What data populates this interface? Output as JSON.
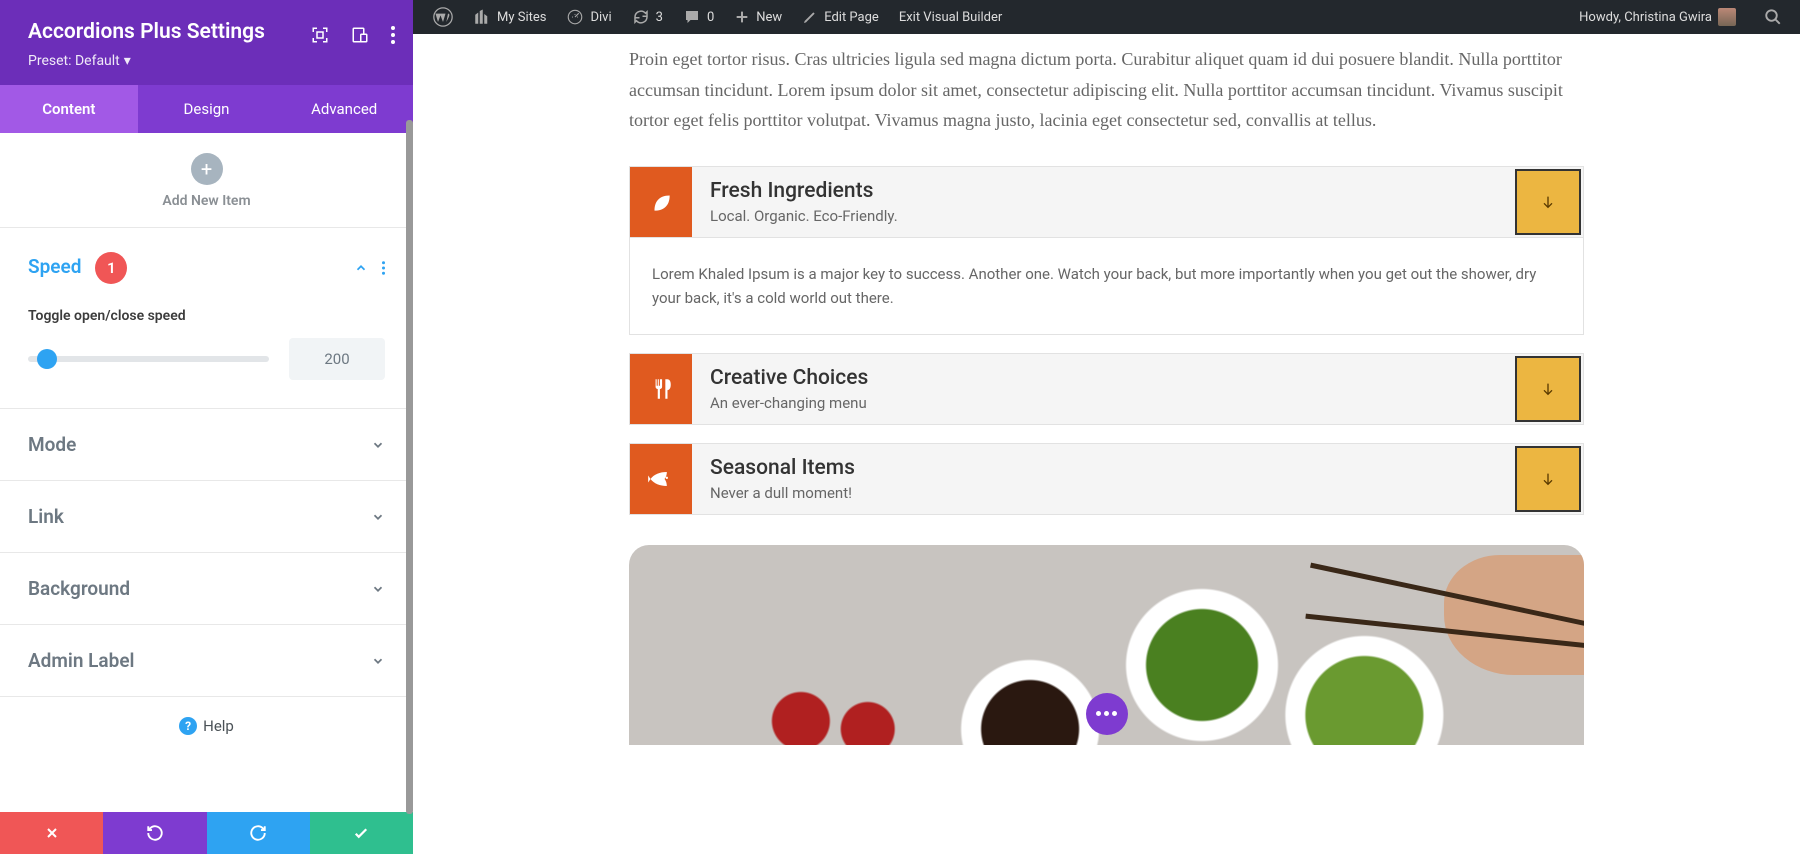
{
  "sidebar": {
    "title": "Accordions Plus Settings",
    "preset": "Preset: Default",
    "tabs": {
      "content": "Content",
      "design": "Design",
      "advanced": "Advanced"
    },
    "addItem": "Add New Item",
    "sections": {
      "speed": {
        "title": "Speed",
        "badge": "1",
        "fieldLabel": "Toggle open/close speed",
        "value": "200"
      },
      "mode": {
        "title": "Mode"
      },
      "link": {
        "title": "Link"
      },
      "background": {
        "title": "Background"
      },
      "adminLabel": {
        "title": "Admin Label"
      }
    },
    "help": "Help"
  },
  "adminBar": {
    "mySites": "My Sites",
    "divi": "Divi",
    "updates": "3",
    "comments": "0",
    "new": "New",
    "editPage": "Edit Page",
    "exitBuilder": "Exit Visual Builder",
    "howdy": "Howdy, Christina Gwira"
  },
  "content": {
    "paragraph": "Proin eget tortor risus. Cras ultricies ligula sed magna dictum porta. Curabitur aliquet quam id dui posuere blandit. Nulla porttitor accumsan tincidunt. Lorem ipsum dolor sit amet, consectetur adipiscing elit. Nulla porttitor accumsan tincidunt. Vivamus suscipit tortor eget felis porttitor volutpat. Vivamus magna justo, lacinia eget consectetur sed, convallis at tellus.",
    "accordions": [
      {
        "title": "Fresh Ingredients",
        "subtitle": "Local. Organic. Eco-Friendly.",
        "body": "Lorem Khaled Ipsum is a major key to success. Another one. Watch your back, but more importantly when you get out the shower, dry your back, it's a cold world out there."
      },
      {
        "title": "Creative Choices",
        "subtitle": "An ever-changing menu"
      },
      {
        "title": "Seasonal Items",
        "subtitle": "Never a dull moment!"
      }
    ]
  }
}
